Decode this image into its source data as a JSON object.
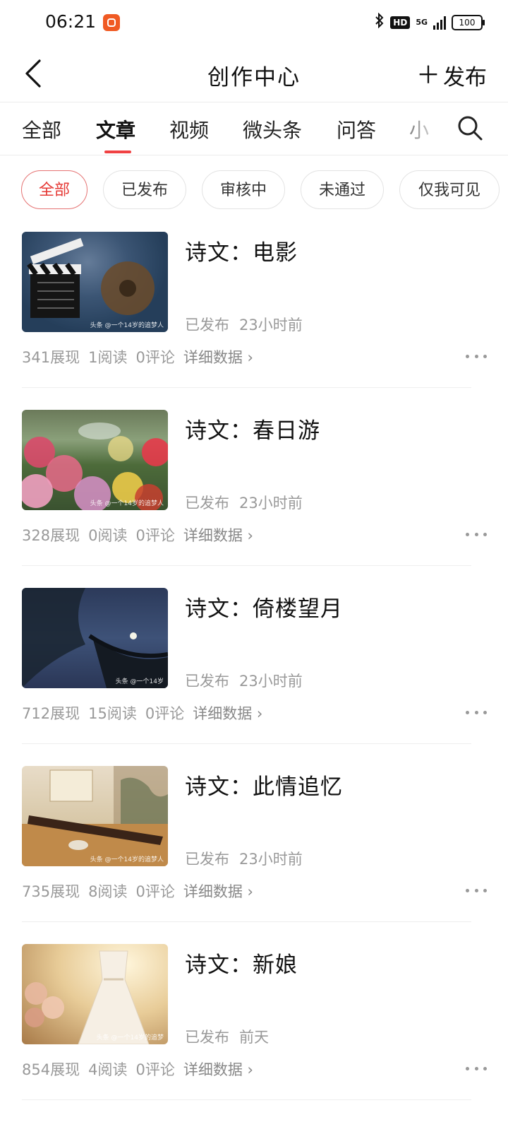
{
  "status_bar": {
    "time": "06:21",
    "network": "5G",
    "hd": "HD",
    "battery": "100"
  },
  "header": {
    "back_icon": "chevron-left-icon",
    "title": "创作中心",
    "publish_label": "发布",
    "publish_icon": "plus-icon"
  },
  "tabs": [
    {
      "label": "全部"
    },
    {
      "label": "文章"
    },
    {
      "label": "视频"
    },
    {
      "label": "微头条"
    },
    {
      "label": "问答"
    },
    {
      "label": "小"
    }
  ],
  "active_tab": "文章",
  "accent_color": "#f04142",
  "filters": [
    {
      "label": "全部"
    },
    {
      "label": "已发布"
    },
    {
      "label": "审核中"
    },
    {
      "label": "未通过"
    },
    {
      "label": "仅我可见"
    }
  ],
  "active_filter": "全部",
  "articles": [
    {
      "title": "诗文：电影",
      "status": "已发布",
      "time": "23小时前",
      "views": "341展现",
      "reads": "1阅读",
      "comments": "0评论",
      "detail": "详细数据 ›",
      "thumb_watermark": "头条 @一个14岁的追梦人"
    },
    {
      "title": "诗文：春日游",
      "status": "已发布",
      "time": "23小时前",
      "views": "328展现",
      "reads": "0阅读",
      "comments": "0评论",
      "detail": "详细数据 ›",
      "thumb_watermark": "头条 @一个14岁的追梦人"
    },
    {
      "title": "诗文：倚楼望月",
      "status": "已发布",
      "time": "23小时前",
      "views": "712展现",
      "reads": "15阅读",
      "comments": "0评论",
      "detail": "详细数据 ›",
      "thumb_watermark": "头条 @一个14岁"
    },
    {
      "title": "诗文：此情追忆",
      "status": "已发布",
      "time": "23小时前",
      "views": "735展现",
      "reads": "8阅读",
      "comments": "0评论",
      "detail": "详细数据 ›",
      "thumb_watermark": "头条 @一个14岁的追梦人"
    },
    {
      "title": "诗文：新娘",
      "status": "已发布",
      "time": "前天",
      "views": "854展现",
      "reads": "4阅读",
      "comments": "0评论",
      "detail": "详细数据 ›",
      "thumb_watermark": "头条 @一个14岁的追梦"
    }
  ]
}
